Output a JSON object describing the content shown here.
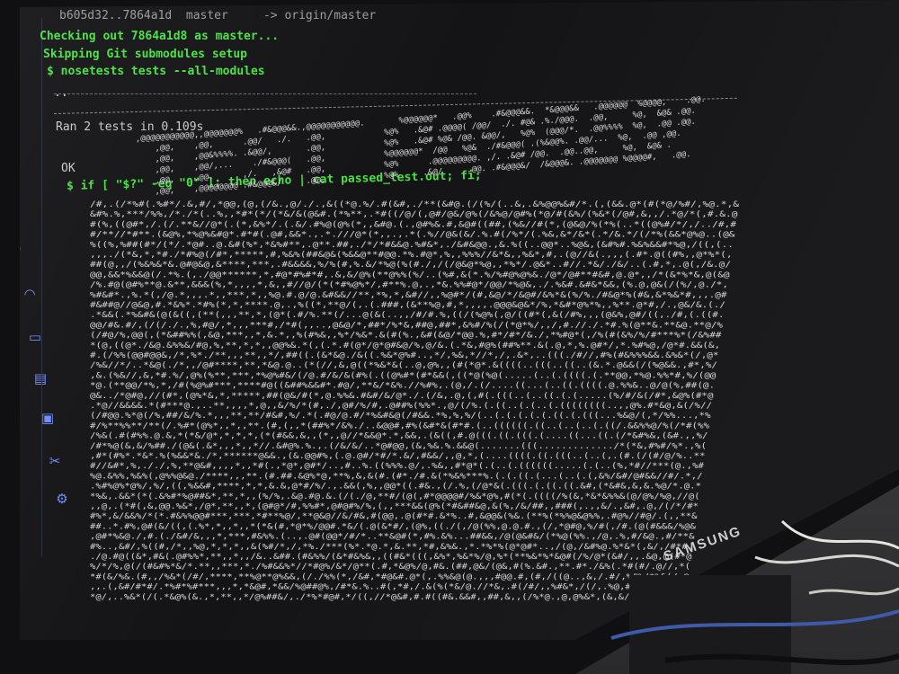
{
  "monitor": {
    "brand": "SAMSUNG"
  },
  "terminal": {
    "lines": [
      "b605d32..7864a1d  master     -> origin/master",
      "Checking out 7864a1d8 as master...",
      "Skipping Git submodules setup",
      "$ nosetests tests --all-modules",
      "..",
      "Ran 2 tests in 0.109s",
      "OK",
      "$ if [ \"$?\" -eq \"0\" ]; then echo | cat passed_test.out; fi;"
    ]
  },
  "ascii_art": {
    "banner_text": "TEST PASSED!",
    "banner_rows": [
      "  ,@@@@@@@@@@@,,@@@@@@@%   .#&@@@&&.,@@@@@@@@@@@.       %@@@@@@*   .@@%    .#&@@@&&.  *&@@@&&   .@@@@@@  %@@@@,    .@@.",
      "      ,@@,    ,@@,      .@@/   ./.   .@@,            %@%   .&@# .@@@@( /@@/  ./. #@& .%./@@@.  .@@,     %@,  &@& .@@.",
      "      ,@@,    ,@@&%%%%. .&@@/,       .@@,            %@%   .&@# %@& /@@. &@@/,   %@%  (@@@/*.  .@@%%%%  %@,  .@@ .@@.",
      "      ,@@,    ,@@/,...    ./#&@@@(   .@@,            %@@@@@@*  /@@   %@&  ./#&@@@( .(%&@@%. .@@/...  %@,  .@@ ,@@.",
      "      ,@@,    ,@@,      ,/.   ,&@#   .@@,            %@%      .@@@@@@@@@. ,/. .&@# /@@.  .@@..@@,     %@,  &@& .",
      "      ,@@,    ,@@@@@@@@ .#&@@@&/     .@@,            %@%     .&@/     .@@. .#&@@@&/  /&@@@&. .@@@@@@@ %@@@@#,   .@@."
    ],
    "fill_glyphs": "*,.(/#&%@"
  },
  "sidebar": {
    "icons": [
      "wifi-icon",
      "n-logo-icon",
      "rocket-icon",
      "headphones-icon",
      "laptop-icon",
      "browser-icon",
      "save-icon",
      "scissors-icon",
      "gear-icon"
    ]
  }
}
